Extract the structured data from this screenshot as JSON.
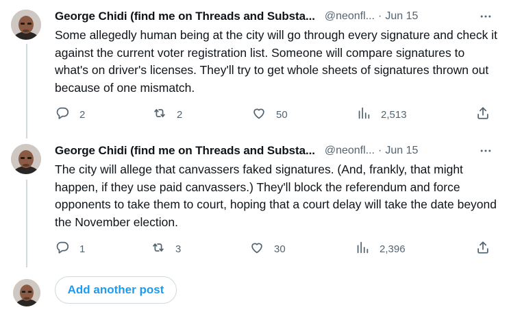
{
  "tweets": [
    {
      "author_name": "George Chidi (find me on Threads and Substa...",
      "handle": "@neonfl...",
      "separator": "·",
      "date": "Jun 15",
      "text": "Some allegedly human being at the city will go through every signature and check it against the current voter registration list. Someone will compare signatures to what's on driver's licenses. They'll try to get whole sheets of signatures thrown out because of one mismatch.",
      "replies": "2",
      "reposts": "2",
      "likes": "50",
      "views": "2,513"
    },
    {
      "author_name": "George Chidi (find me on Threads and Substa...",
      "handle": "@neonfl...",
      "separator": "·",
      "date": "Jun 15",
      "text": "The city will allege that canvassers faked signatures. (And, frankly, that might happen, if they use paid canvassers.) They'll block the referendum and force opponents to take them to court, hoping that a court delay will take the date beyond the November election.",
      "replies": "1",
      "reposts": "3",
      "likes": "30",
      "views": "2,396"
    }
  ],
  "composer": {
    "add_post_label": "Add another post"
  },
  "icons": {
    "reply": "reply-icon",
    "repost": "repost-icon",
    "like": "heart-icon",
    "views": "views-chart-icon",
    "share": "share-icon",
    "more": "more-icon"
  },
  "colors": {
    "accent": "#1d9bf0",
    "secondary_text": "#536471",
    "thread_line": "#cfd9de"
  }
}
